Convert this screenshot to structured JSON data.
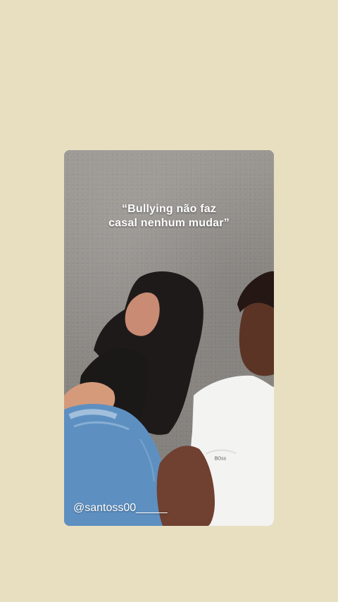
{
  "story": {
    "quote": "“Bullying não faz\ncasal nenhum mudar”",
    "handle": "@santoss00_____"
  },
  "colors": {
    "background": "#e8dfc1",
    "wall": "#8e8b87",
    "shirt": "#f3f3f1",
    "denim": "#5c8fc0"
  }
}
